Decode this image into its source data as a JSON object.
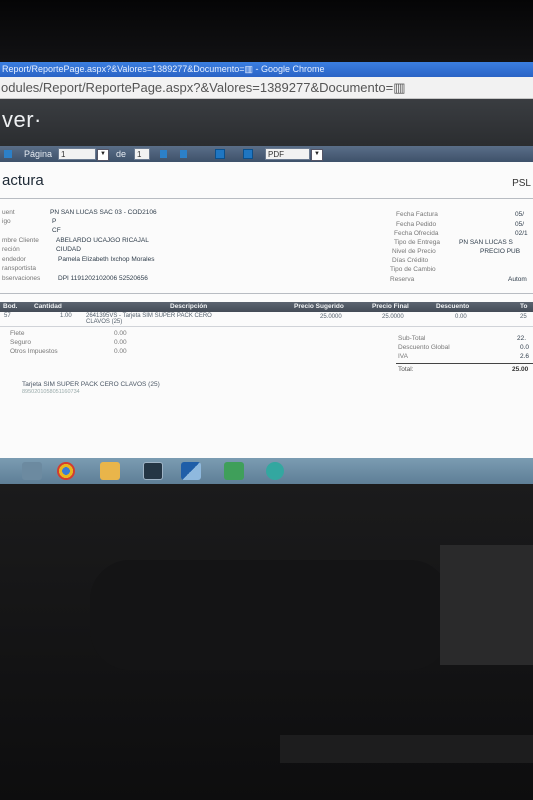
{
  "browser": {
    "window_title": "Report/ReportePage.aspx?&Valores=1389277&Documento=▥ - Google Chrome",
    "address": "odules/Report/ReportePage.aspx?&Valores=1389277&Documento=▥"
  },
  "app": {
    "brand": "ver·"
  },
  "toolbar": {
    "page_label": "Página",
    "page_value": "1",
    "of_label": "de",
    "total_pages": "1",
    "export_format": "PDF"
  },
  "report": {
    "title": "actura",
    "code": "PSL",
    "left_fields": [
      {
        "label": "uent",
        "value": "PN SAN LUCAS SAC 03 - COD2106"
      },
      {
        "label": "igo",
        "value": "P"
      },
      {
        "label": "",
        "value": "CF"
      },
      {
        "label": "mbre Cliente",
        "value": "ABELARDO UCAJGO RICAJAL"
      },
      {
        "label": "reción",
        "value": "CIUDAD"
      },
      {
        "label": "endedor",
        "value": "Pamela Elizabeth Ixchop Morales"
      },
      {
        "label": "ransportista",
        "value": ""
      },
      {
        "label": "bservaciones",
        "value": "DPI 1191202102006  52520656"
      }
    ],
    "right_fields": [
      {
        "label": "Fecha Factura",
        "value": "05/"
      },
      {
        "label": "Fecha Pedido",
        "value": "05/"
      },
      {
        "label": "Fecha Ofrecida",
        "value": "02/1"
      },
      {
        "label": "Tipo de Entrega",
        "value": "PN SAN LUCAS S"
      },
      {
        "label": "Nivel de Precio",
        "value": "PRECIO PUB"
      },
      {
        "label": "Días Crédito",
        "value": ""
      },
      {
        "label": "Tipo de Cambio",
        "value": ""
      },
      {
        "label": "Reserva",
        "value": "Autom"
      }
    ],
    "table": {
      "headers": [
        "Bod.",
        "Cantidad",
        "Descripción",
        "Precio Sugerido",
        "Precio Final",
        "Descuento",
        "To"
      ],
      "row": {
        "bod": "57",
        "cantidad": "1.00",
        "descripcion_1": "2641395VS - Tarjeta SIM SUPER PACK CERO",
        "descripcion_2": "CLAVOS (25)",
        "precio_sugerido": "25.0000",
        "precio_final": "25.0000",
        "descuento": "0.00",
        "total": "25"
      }
    },
    "charges": [
      {
        "label": "Flete",
        "value": "0.00"
      },
      {
        "label": "Seguro",
        "value": "0.00"
      },
      {
        "label": "Otros Impuestos",
        "value": "0.00"
      }
    ],
    "summary": [
      {
        "label": "Sub-Total",
        "value": "22."
      },
      {
        "label": "Descuento Global",
        "value": "0.0"
      },
      {
        "label": "IVA",
        "value": "2.6"
      }
    ],
    "total_label": "Total:",
    "total_value": "25.00",
    "note_title": "Tarjeta SIM SUPER PACK CERO CLAVOS (25)",
    "note_serial": "8950201058051160734"
  },
  "taskbar": {
    "icons": [
      "windows-explorer-icon",
      "chrome-icon",
      "folder-icon",
      "app-icon",
      "app-blue-icon",
      "excel-icon",
      "app-teal-icon"
    ]
  },
  "colors": {
    "titlebar": "#2a63c6",
    "header_bar": "#2b2d30",
    "report_toolbar": "#3e516a",
    "table_header": "#444c57",
    "taskbar": "#5e7e96"
  }
}
